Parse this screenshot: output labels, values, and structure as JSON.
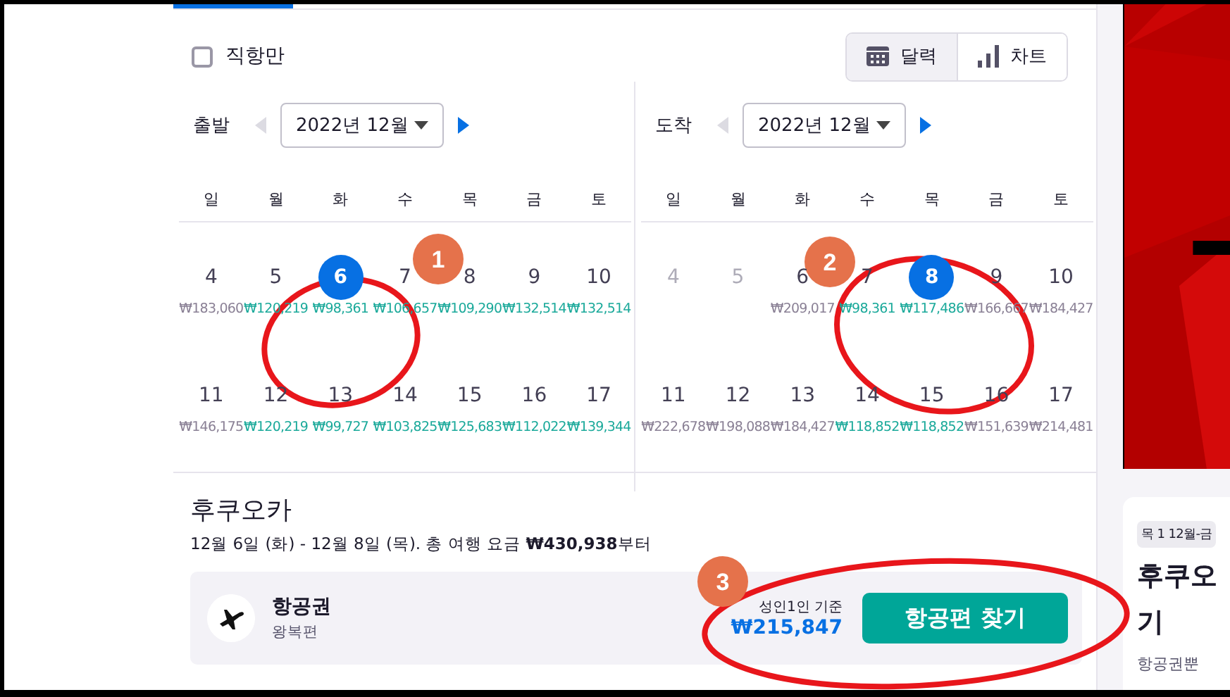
{
  "direct_only": {
    "label": "직항만",
    "checked": false
  },
  "view_toggle": [
    {
      "label": "달력",
      "kind": "calendar",
      "selected": true
    },
    {
      "label": "차트",
      "kind": "chart",
      "selected": false
    }
  ],
  "calendars": [
    {
      "label": "출발",
      "month": "2022년 12월",
      "weekdays": [
        "일",
        "월",
        "화",
        "수",
        "목",
        "금",
        "토"
      ],
      "days": [
        {
          "day": "4",
          "price": "₩183,060",
          "color": "#8a8095",
          "selected": false,
          "disabled": false
        },
        {
          "day": "5",
          "price": "₩120,219",
          "color": "#1aa99a",
          "selected": false,
          "disabled": false
        },
        {
          "day": "6",
          "price": "₩98,361",
          "color": "#1aa99a",
          "selected": true,
          "disabled": false
        },
        {
          "day": "7",
          "price": "₩106,657",
          "color": "#1aa99a",
          "selected": false,
          "disabled": false
        },
        {
          "day": "8",
          "price": "₩109,290",
          "color": "#1aa99a",
          "selected": false,
          "disabled": false
        },
        {
          "day": "9",
          "price": "₩132,514",
          "color": "#1aa99a",
          "selected": false,
          "disabled": false
        },
        {
          "day": "10",
          "price": "₩132,514",
          "color": "#1aa99a",
          "selected": false,
          "disabled": false
        },
        {
          "day": "11",
          "price": "₩146,175",
          "color": "#8a8095",
          "selected": false,
          "disabled": false
        },
        {
          "day": "12",
          "price": "₩120,219",
          "color": "#1aa99a",
          "selected": false,
          "disabled": false
        },
        {
          "day": "13",
          "price": "₩99,727",
          "color": "#1aa99a",
          "selected": false,
          "disabled": false
        },
        {
          "day": "14",
          "price": "₩103,825",
          "color": "#1aa99a",
          "selected": false,
          "disabled": false
        },
        {
          "day": "15",
          "price": "₩125,683",
          "color": "#1aa99a",
          "selected": false,
          "disabled": false
        },
        {
          "day": "16",
          "price": "₩112,022",
          "color": "#1aa99a",
          "selected": false,
          "disabled": false
        },
        {
          "day": "17",
          "price": "₩139,344",
          "color": "#1aa99a",
          "selected": false,
          "disabled": false
        }
      ]
    },
    {
      "label": "도착",
      "month": "2022년 12월",
      "weekdays": [
        "일",
        "월",
        "화",
        "수",
        "목",
        "금",
        "토"
      ],
      "days": [
        {
          "day": "4",
          "selected": false,
          "disabled": true
        },
        {
          "day": "5",
          "selected": false,
          "disabled": true
        },
        {
          "day": "6",
          "price": "₩209,017",
          "color": "#8a8095",
          "selected": false,
          "disabled": false
        },
        {
          "day": "7",
          "price": "₩98,361",
          "color": "#1aa99a",
          "selected": false,
          "disabled": false
        },
        {
          "day": "8",
          "price": "₩117,486",
          "color": "#1aa99a",
          "selected": true,
          "disabled": false
        },
        {
          "day": "9",
          "price": "₩166,667",
          "color": "#8a8095",
          "selected": false,
          "disabled": false
        },
        {
          "day": "10",
          "price": "₩184,427",
          "color": "#8a8095",
          "selected": false,
          "disabled": false
        },
        {
          "day": "11",
          "price": "₩222,678",
          "color": "#8a8095",
          "selected": false,
          "disabled": false
        },
        {
          "day": "12",
          "price": "₩198,088",
          "color": "#8a8095",
          "selected": false,
          "disabled": false
        },
        {
          "day": "13",
          "price": "₩184,427",
          "color": "#8a8095",
          "selected": false,
          "disabled": false
        },
        {
          "day": "14",
          "price": "₩118,852",
          "color": "#1aa99a",
          "selected": false,
          "disabled": false
        },
        {
          "day": "15",
          "price": "₩118,852",
          "color": "#1aa99a",
          "selected": false,
          "disabled": false
        },
        {
          "day": "16",
          "price": "₩151,639",
          "color": "#8a8095",
          "selected": false,
          "disabled": false
        },
        {
          "day": "17",
          "price": "₩214,481",
          "color": "#8a8095",
          "selected": false,
          "disabled": false
        }
      ]
    }
  ],
  "summary": {
    "title": "후쿠오카",
    "dates": "12월 6일 (화) - 12월 8일 (목). 총 여행 요금 **₩430,938**부터"
  },
  "flight": {
    "title": "항공권",
    "subtitle": "왕복편",
    "price_label": "성인1인 기준",
    "price": "₩215,847",
    "button": "항공편 찾기"
  },
  "side_card": {
    "tag": "목 1 12월-금",
    "title_lines": [
      "후쿠오",
      "기"
    ],
    "text": "항공권뿐"
  },
  "annotations": [
    {
      "label": "1"
    },
    {
      "label": "2"
    },
    {
      "label": "3"
    }
  ]
}
